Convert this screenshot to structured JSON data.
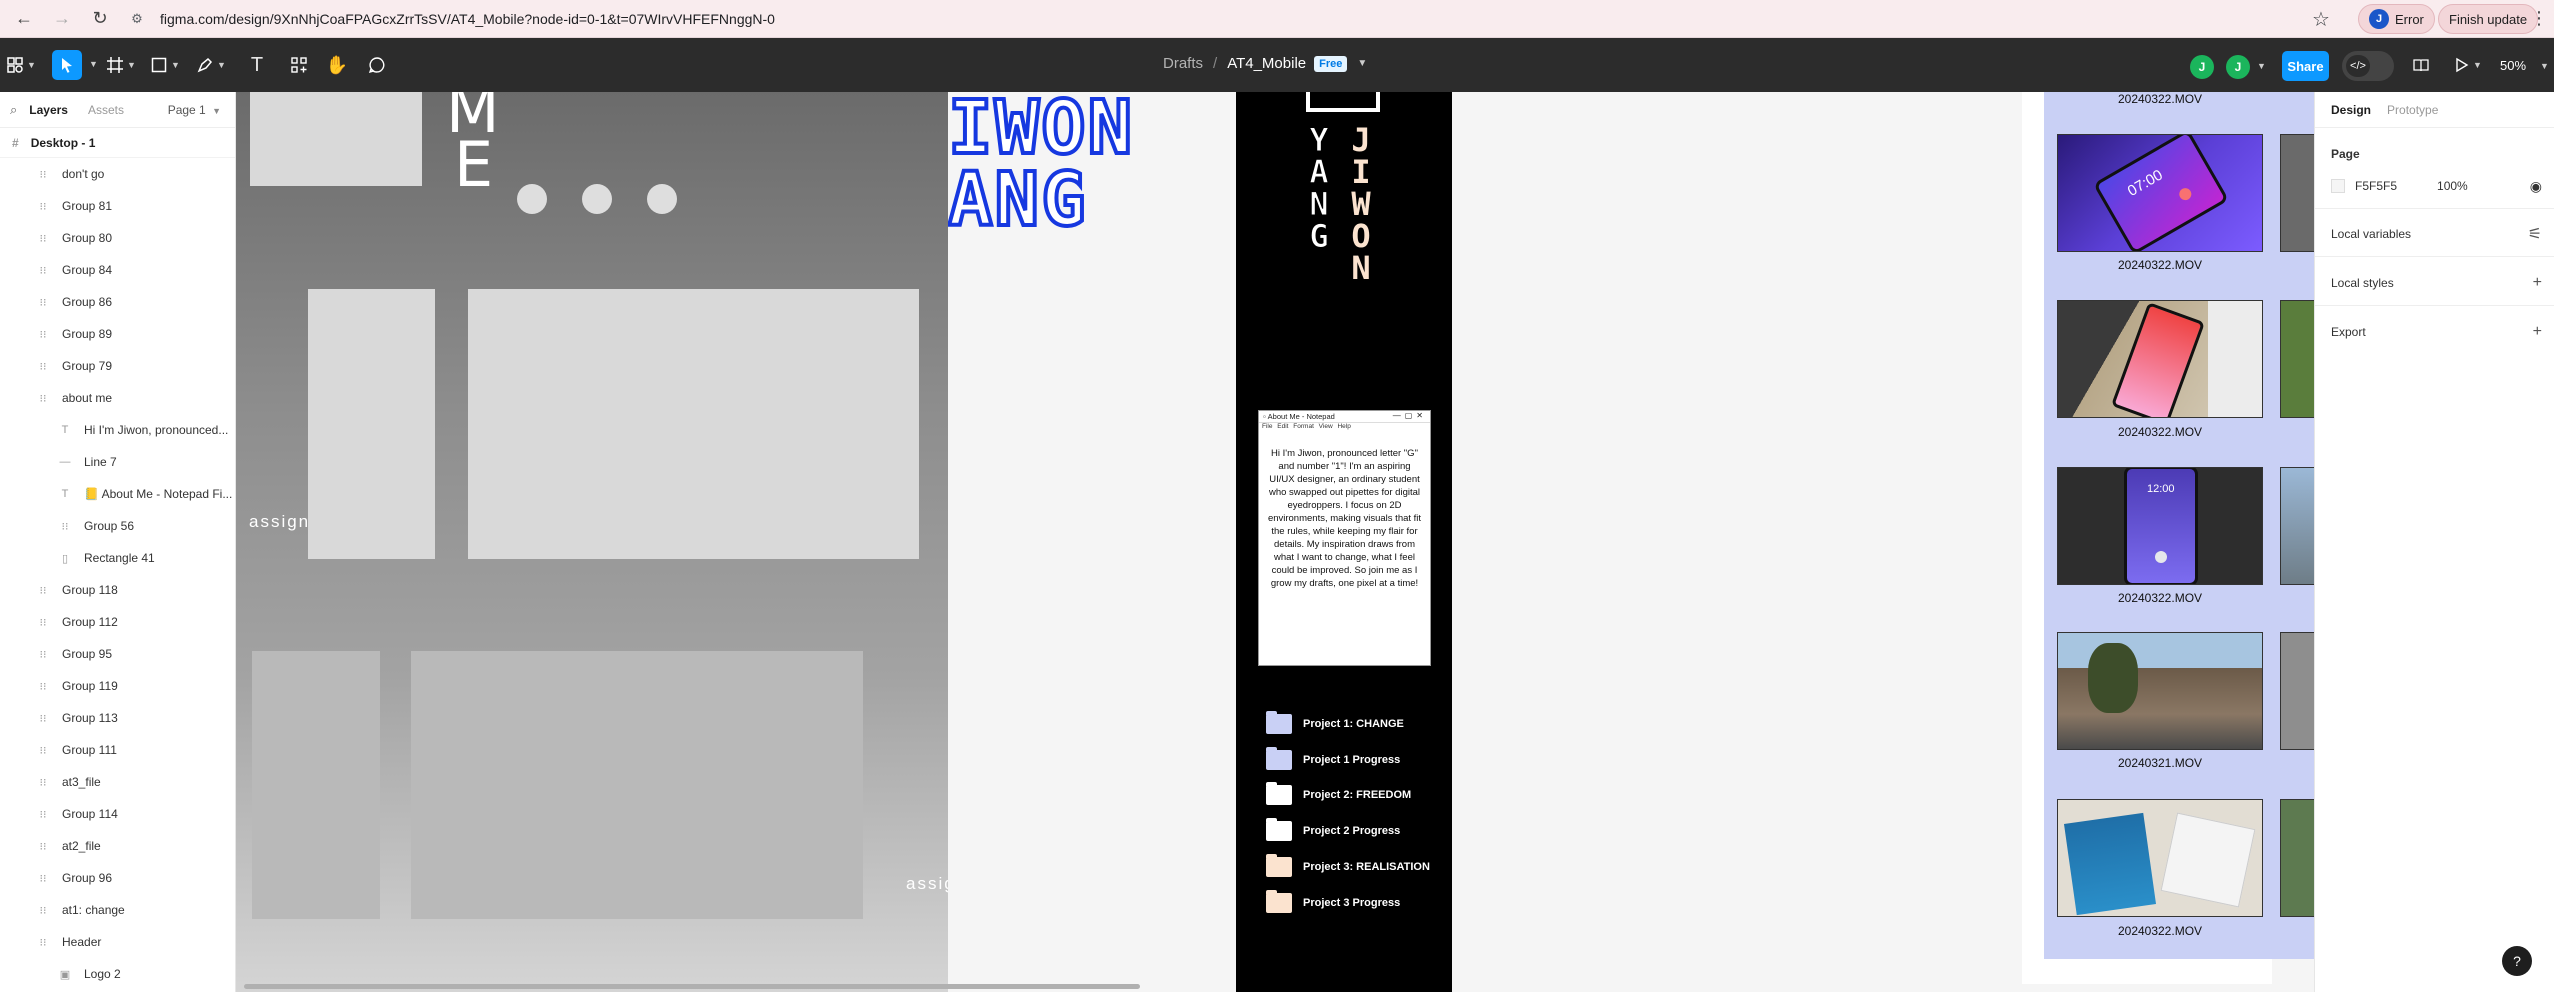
{
  "browser": {
    "url": "figma.com/design/9XnNhjCoaFPAGcxZrrTsSV/AT4_Mobile?node-id=0-1&t=07WIrvVHFEFNnggN-0",
    "profile_initial": "J",
    "error_label": "Error",
    "update_label": "Finish update"
  },
  "toolbar": {
    "breadcrumb_drafts": "Drafts",
    "breadcrumb_sep": "/",
    "file_name": "AT4_Mobile",
    "plan_badge": "Free",
    "avatar_1": "J",
    "avatar_2": "J",
    "share_label": "Share",
    "zoom": "50%"
  },
  "left_panel": {
    "tab_layers": "Layers",
    "tab_assets": "Assets",
    "page_select": "Page 1",
    "frame_name": "Desktop - 1",
    "layers": [
      {
        "label": "don't go",
        "icon": "group-icon",
        "level": 0
      },
      {
        "label": "Group 81",
        "icon": "group-icon",
        "level": 0
      },
      {
        "label": "Group 80",
        "icon": "group-icon",
        "level": 0
      },
      {
        "label": "Group 84",
        "icon": "group-icon",
        "level": 0
      },
      {
        "label": "Group 86",
        "icon": "group-icon",
        "level": 0
      },
      {
        "label": "Group 89",
        "icon": "group-icon",
        "level": 0
      },
      {
        "label": "Group 79",
        "icon": "group-icon",
        "level": 0
      },
      {
        "label": "about me",
        "icon": "group-icon",
        "level": 0
      },
      {
        "label": "Hi I'm Jiwon, pronounced...",
        "icon": "text-icon",
        "level": 1
      },
      {
        "label": "Line 7",
        "icon": "line-icon",
        "level": 1
      },
      {
        "label": "📒 About Me - Notepad Fi...",
        "icon": "text-icon",
        "level": 1
      },
      {
        "label": "Group 56",
        "icon": "group-icon",
        "level": 1
      },
      {
        "label": "Rectangle 41",
        "icon": "rectangle-icon",
        "level": 1
      },
      {
        "label": "Group 118",
        "icon": "group-icon",
        "level": 0
      },
      {
        "label": "Group 112",
        "icon": "group-icon",
        "level": 0
      },
      {
        "label": "Group 95",
        "icon": "group-icon",
        "level": 0
      },
      {
        "label": "Group 119",
        "icon": "group-icon",
        "level": 0
      },
      {
        "label": "Group 113",
        "icon": "group-icon",
        "level": 0
      },
      {
        "label": "Group 111",
        "icon": "group-icon",
        "level": 0
      },
      {
        "label": "at3_file",
        "icon": "group-icon",
        "level": 0
      },
      {
        "label": "Group 114",
        "icon": "group-icon",
        "level": 0
      },
      {
        "label": "at2_file",
        "icon": "group-icon",
        "level": 0
      },
      {
        "label": "Group 96",
        "icon": "group-icon",
        "level": 0
      },
      {
        "label": "at1: change",
        "icon": "group-icon",
        "level": 0
      },
      {
        "label": "Header",
        "icon": "group-icon",
        "level": 0
      },
      {
        "label": "Logo 2",
        "icon": "image-icon",
        "level": 1
      }
    ]
  },
  "canvas": {
    "letter_m": "M",
    "letter_e": "E",
    "vertical_assign": "assign",
    "vertical_assign_2": "assig",
    "pixel_title": "IWON\nANG",
    "vertical_jiwon": "JIWON",
    "vertical_yang": "YANG",
    "notepad": {
      "title": "About Me - Notepad",
      "menu": "File Edit Format View Help",
      "body": "Hi I'm Jiwon, pronounced letter \"G\" and number \"1\"! I'm an aspiring UI/UX designer, an ordinary student who swapped out pipettes for digital eyedroppers. I focus on 2D environments, making visuals that fit the rules, while keeping my flair for details. My inspiration draws from what I want to change, what I feel could be improved. So join me as I grow my drafts, one pixel at a time!"
    },
    "projects": [
      {
        "label": "Project 1: CHANGE",
        "folder_color": "#c9d0f5"
      },
      {
        "label": "Project 1 Progress",
        "folder_color": "#c9d0f5"
      },
      {
        "label": "Project 2: FREEDOM",
        "folder_color": "#ffffff"
      },
      {
        "label": "Project 2 Progress",
        "folder_color": "#ffffff"
      },
      {
        "label": "Project 3: REALISATION",
        "folder_color": "#fbe3cf"
      },
      {
        "label": "Project 3 Progress",
        "folder_color": "#fbe3cf"
      }
    ],
    "media_files": [
      "20240322.MOV",
      "20240322.MOV",
      "20240322.MOV",
      "20240322.MOV",
      "20240321.MOV",
      "20240322.MOV"
    ],
    "phone_clock_1": "07:00",
    "phone_clock_2": "12:00"
  },
  "right_panel": {
    "tab_design": "Design",
    "tab_prototype": "Prototype",
    "page_label": "Page",
    "bg_color": "F5F5F5",
    "bg_opacity": "100%",
    "local_variables": "Local variables",
    "local_styles": "Local styles",
    "export": "Export"
  },
  "help_label": "?",
  "colors": {
    "accent": "#0d99ff",
    "toolbar_bg": "#2c2c2c",
    "canvas_bg": "#f5f5f5",
    "pixel_title_stroke": "#1638e0",
    "media_board": "#c9d0f5"
  }
}
